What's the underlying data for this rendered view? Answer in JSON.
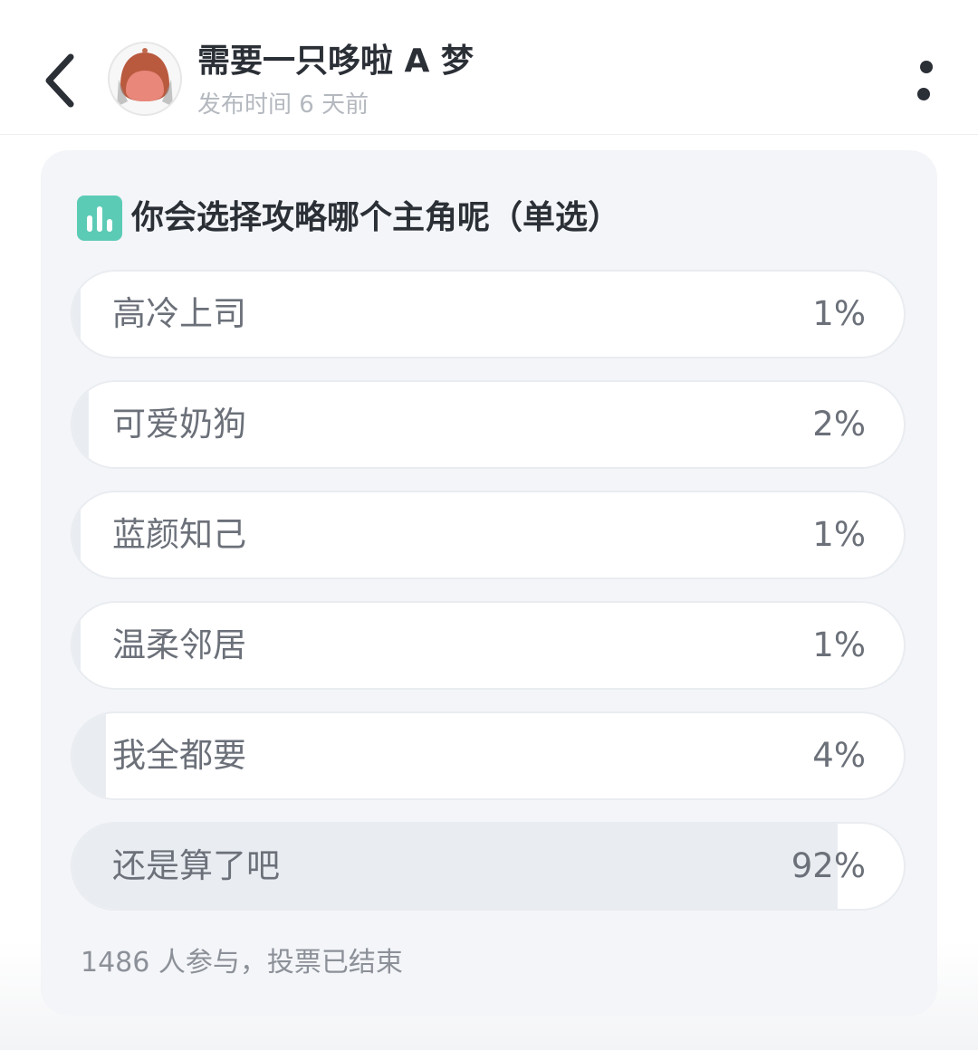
{
  "header": {
    "title": "需要一只哆啦 A 梦",
    "time": "发布时间 6 天前",
    "back_icon": "chevron-left-icon",
    "more_icon": "more-vertical-icon"
  },
  "poll": {
    "icon": "bar-chart-icon",
    "accent_color": "#5ccbb6",
    "question": "你会选择攻略哪个主角呢（单选）",
    "options": [
      {
        "label": "高冷上司",
        "percent_text": "1%",
        "percent": 1
      },
      {
        "label": "可爱奶狗",
        "percent_text": "2%",
        "percent": 2
      },
      {
        "label": "蓝颜知己",
        "percent_text": "1%",
        "percent": 1
      },
      {
        "label": "温柔邻居",
        "percent_text": "1%",
        "percent": 1
      },
      {
        "label": "我全都要",
        "percent_text": "4%",
        "percent": 4
      },
      {
        "label": "还是算了吧",
        "percent_text": "92%",
        "percent": 92
      }
    ],
    "footer": "1486 人参与，投票已结束"
  }
}
